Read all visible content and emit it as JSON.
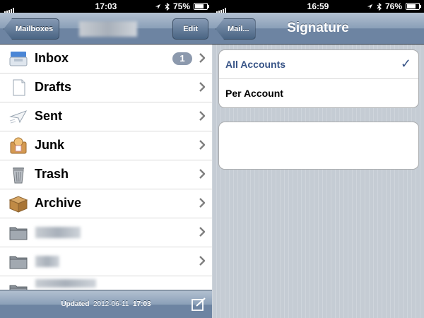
{
  "left": {
    "status": {
      "time": "17:03",
      "battery": "75%",
      "battery_level": 0.75
    },
    "nav": {
      "back": "Mailboxes",
      "edit": "Edit"
    },
    "mailboxes": [
      {
        "label": "Inbox",
        "icon": "inbox-icon",
        "badge": "1"
      },
      {
        "label": "Drafts",
        "icon": "drafts-icon"
      },
      {
        "label": "Sent",
        "icon": "sent-icon"
      },
      {
        "label": "Junk",
        "icon": "junk-icon"
      },
      {
        "label": "Trash",
        "icon": "trash-icon"
      },
      {
        "label": "Archive",
        "icon": "archive-icon"
      }
    ],
    "toolbar": {
      "updated_label": "Updated",
      "updated_date": "2012-06-11",
      "updated_time": "17:03"
    }
  },
  "right": {
    "status": {
      "time": "16:59",
      "battery": "76%",
      "battery_level": 0.76
    },
    "nav": {
      "back": "Mail...",
      "title": "Signature"
    },
    "options": [
      {
        "label": "All Accounts",
        "selected": true
      },
      {
        "label": "Per Account",
        "selected": false
      }
    ]
  },
  "colors": {
    "nav_bar": "#6d84a2",
    "selected_text": "#385487",
    "badge": "#8c99ad",
    "group_bg": "#c5ccd4"
  }
}
